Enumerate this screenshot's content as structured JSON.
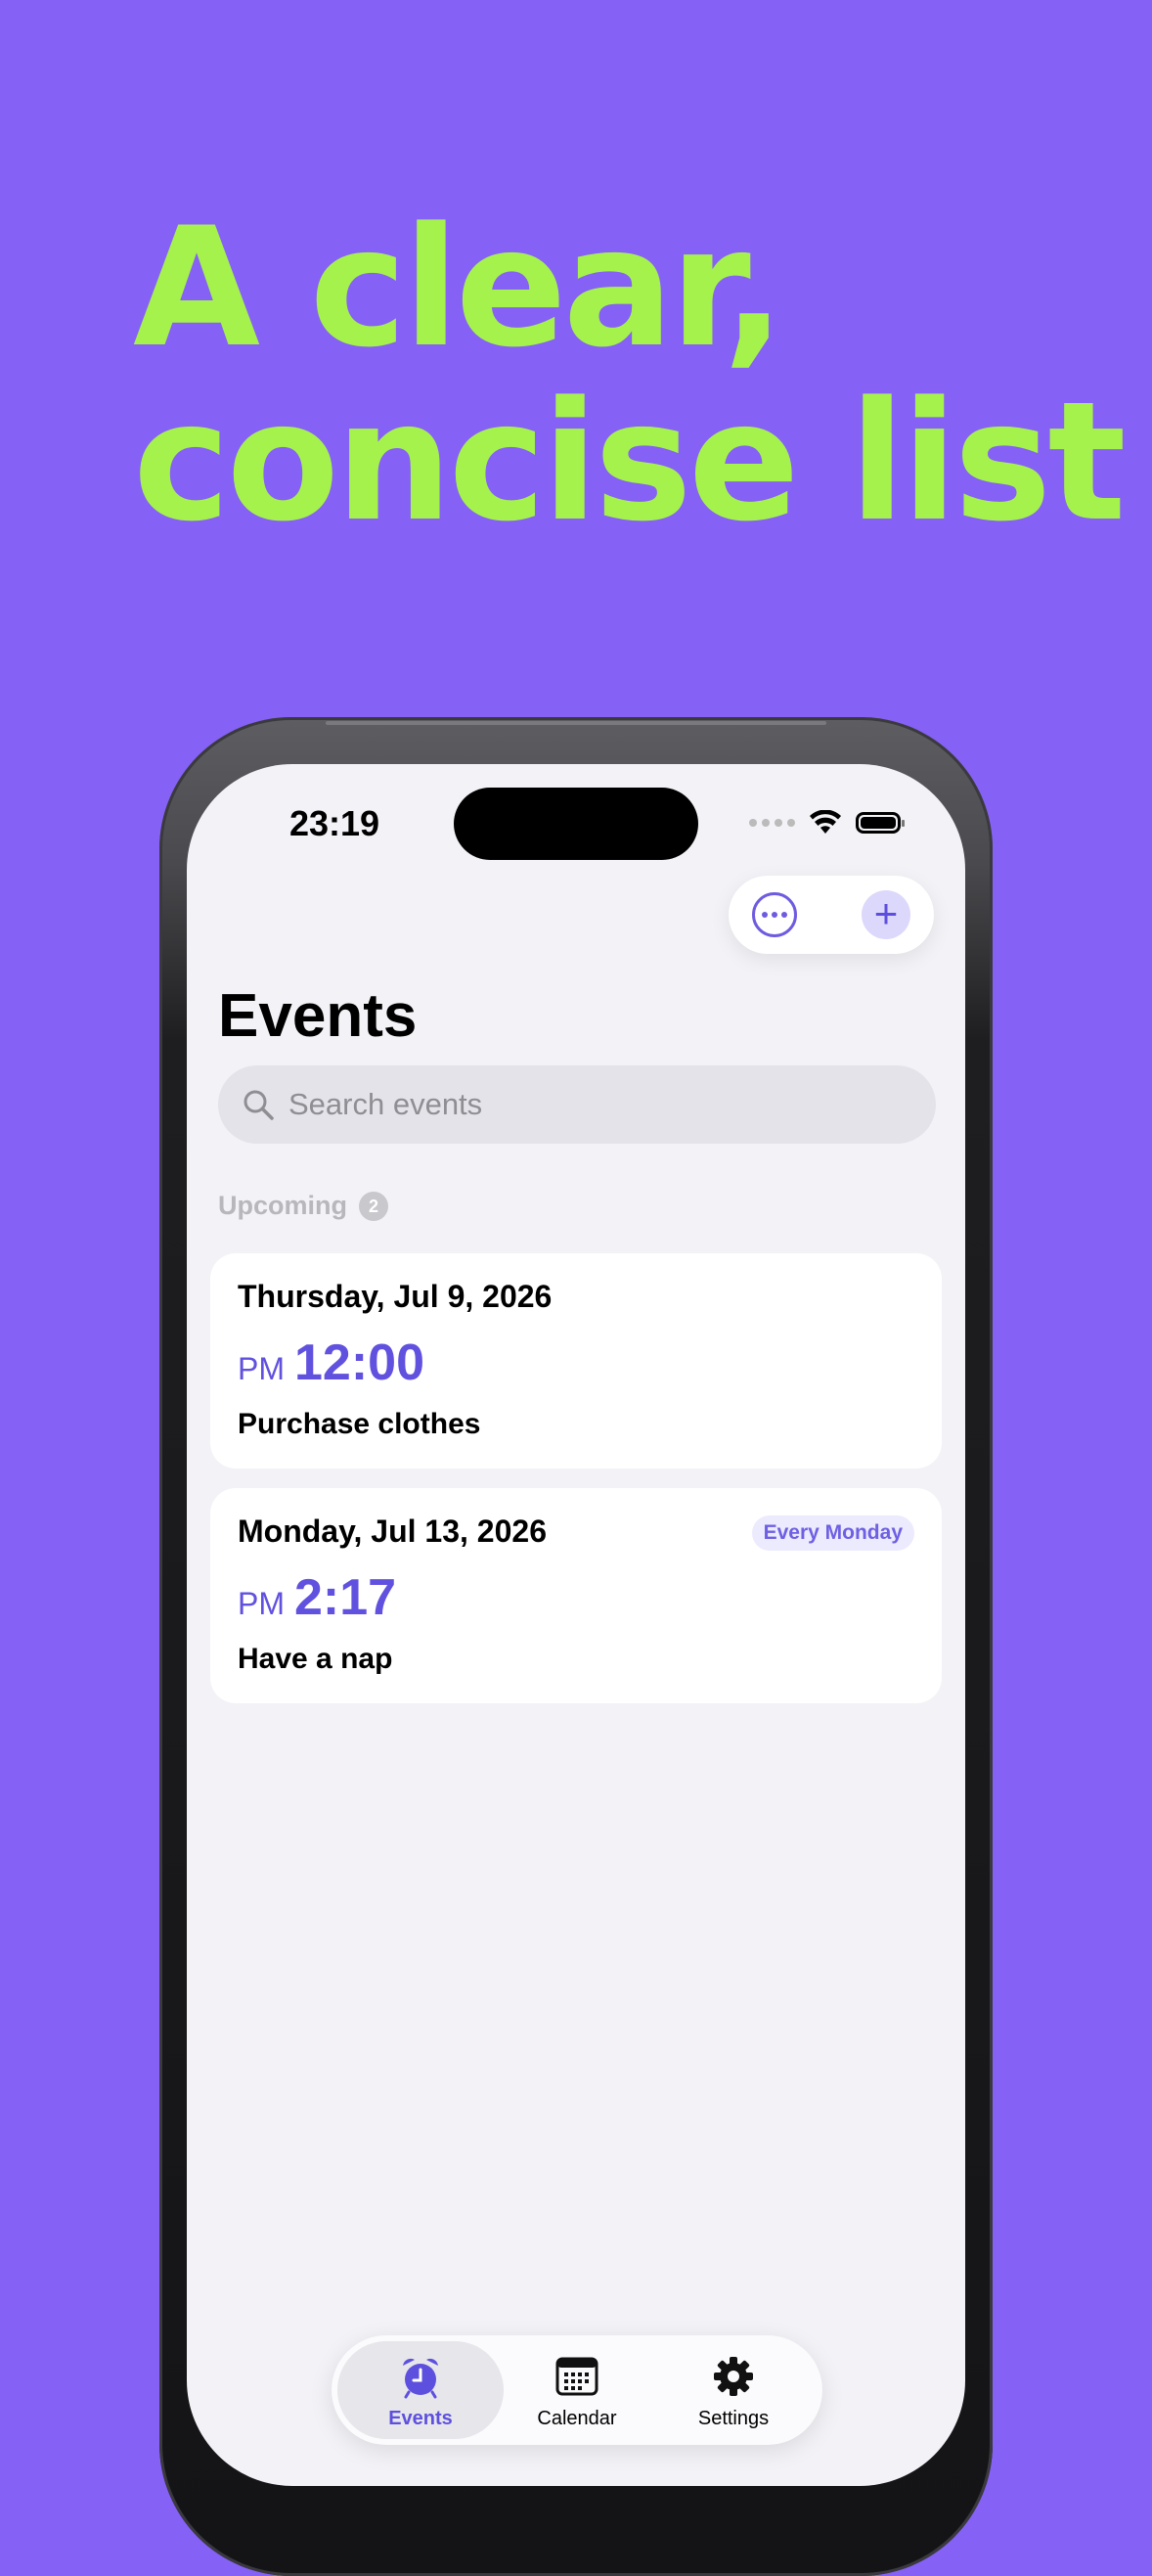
{
  "promo": {
    "headline_line1": "A clear,",
    "headline_line2": "concise list"
  },
  "status_bar": {
    "time": "23:19"
  },
  "header": {
    "title": "Events",
    "more_icon": "ellipsis-circle-icon",
    "add_icon": "plus-icon",
    "add_label": "+"
  },
  "search": {
    "placeholder": "Search events"
  },
  "section": {
    "label": "Upcoming",
    "count": "2"
  },
  "events": [
    {
      "date": "Thursday, Jul 9, 2026",
      "ampm": "PM",
      "time": "12:00",
      "title": "Purchase clothes",
      "repeat": ""
    },
    {
      "date": "Monday, Jul 13, 2026",
      "ampm": "PM",
      "time": "2:17",
      "title": "Have a nap",
      "repeat": "Every Monday"
    }
  ],
  "tabbar": {
    "tabs": [
      {
        "label": "Events",
        "icon": "alarm-clock-icon",
        "active": true
      },
      {
        "label": "Calendar",
        "icon": "calendar-icon",
        "active": false
      },
      {
        "label": "Settings",
        "icon": "gear-icon",
        "active": false
      }
    ]
  },
  "colors": {
    "background": "#8561F5",
    "headline": "#A6F24C",
    "accent": "#6151DF"
  }
}
